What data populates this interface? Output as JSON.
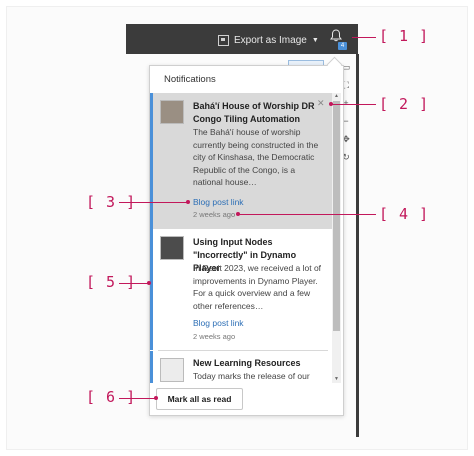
{
  "toolbar": {
    "export_label": "Export as Image",
    "export_caret": "▼",
    "export_icon": "image-export-icon",
    "bell_icon": "bell-icon",
    "bell_badge": "4"
  },
  "side_tools": [
    "▭",
    "⛶",
    "+",
    "−",
    "✥",
    "↻"
  ],
  "notifications": {
    "title": "Notifications",
    "items": [
      {
        "title": "Bahá'í House of Worship DR Congo Tiling Automation",
        "body": "The Bahá'í house of worship currently being constructed in the city of Kinshasa, the Democratic Republic of the Congo, is a national house…",
        "link": "Blog post link",
        "time": "2 weeks ago",
        "close": "✕"
      },
      {
        "title": "Using Input Nodes \"Incorrectly\" in Dynamo Player",
        "body": "In Revit 2023, we received a lot of improvements in Dynamo Player. For a quick overview and a few other references…",
        "link": "Blog post link",
        "time": "2 weeks ago"
      },
      {
        "title": "New Learning Resources",
        "body": "Today marks the release of our"
      }
    ],
    "mark_all_label": "Mark all as read"
  },
  "callouts": [
    "[ 1 ]",
    "[ 2 ]",
    "[ 3 ]",
    "[ 4 ]",
    "[ 5 ]",
    "[ 6 ]"
  ],
  "colors": {
    "callout": "#c2185b",
    "link": "#2d6fb6",
    "unread_bg": "#d9d9d9",
    "accent": "#4a90d9",
    "toolbar_bg": "#3b3b3b"
  }
}
